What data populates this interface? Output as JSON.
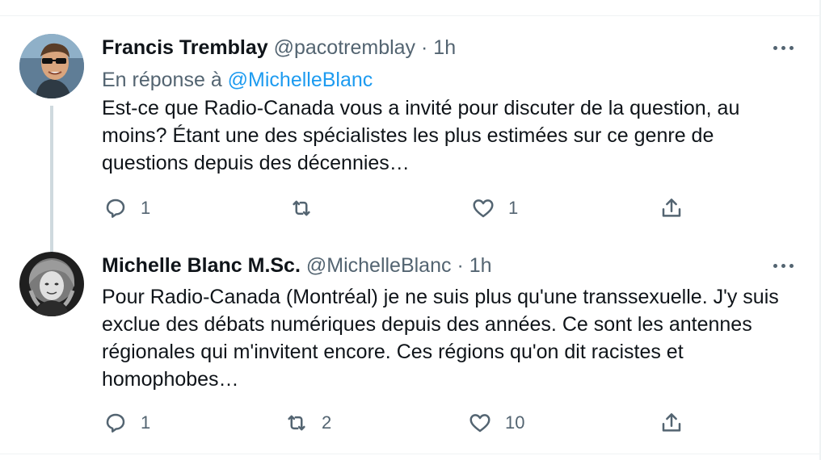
{
  "tweets": [
    {
      "name": "Francis Tremblay",
      "handle": "@pacotremblay",
      "separator": "·",
      "time": "1h",
      "reply_prefix": "En réponse à",
      "reply_mention": "@MichelleBlanc",
      "text": "Est-ce que Radio-Canada vous a invité pour discuter de la question, au moins? Étant une des spécialistes les plus estimées sur ce genre de questions depuis des décennies…",
      "avatar_icon": "avatar-photo",
      "actions": {
        "reply_count": "1",
        "retweet_count": "",
        "like_count": "1"
      }
    },
    {
      "name": "Michelle Blanc M.Sc.",
      "handle": "@MichelleBlanc",
      "separator": "·",
      "time": "1h",
      "text": "Pour Radio-Canada (Montréal) je ne suis plus qu'une transsexuelle. J'y suis exclue des débats numériques depuis des années. Ce sont les antennes régionales qui m'invitent encore. Ces régions qu'on dit racistes et homophobes…",
      "avatar_icon": "avatar-photo",
      "actions": {
        "reply_count": "1",
        "retweet_count": "2",
        "like_count": "10"
      }
    }
  ],
  "icons": {
    "more": "more-dots-icon",
    "reply": "reply-bubble-icon",
    "retweet": "retweet-arrows-icon",
    "like": "heart-icon",
    "share": "share-upload-icon"
  },
  "colors": {
    "text": "#0f1419",
    "secondary": "#536471",
    "link": "#1d9bf0",
    "thread_line": "#cfd9de"
  }
}
